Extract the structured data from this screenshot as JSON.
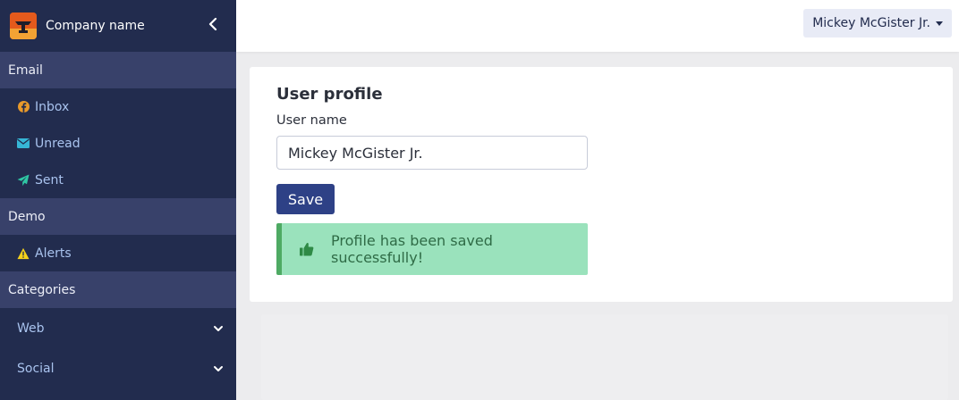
{
  "sidebar": {
    "brand": "Company name",
    "sections": [
      {
        "label": "Email"
      },
      {
        "label": "Demo"
      },
      {
        "label": "Categories"
      }
    ],
    "email_items": [
      "Inbox",
      "Unread",
      "Sent"
    ],
    "demo_items": [
      "Alerts"
    ],
    "category_items": [
      "Web",
      "Social"
    ]
  },
  "topbar": {
    "user_name": "Mickey McGister Jr."
  },
  "profile": {
    "title": "User profile",
    "field_label": "User name",
    "field_value": "Mickey McGister Jr.",
    "save_label": "Save",
    "success_message": "Profile has been saved successfully!"
  },
  "colors": {
    "sidebar_bg": "#222c4e",
    "section_bg": "#38416a",
    "primary": "#2e4186",
    "success_bg": "#9ae2bc",
    "success_border": "#4eaa63"
  },
  "icons": {
    "inbox": "facebook-circle-icon",
    "unread": "envelope-icon",
    "sent": "paper-plane-icon",
    "alerts": "warning-triangle-icon",
    "success": "thumbs-up-icon"
  }
}
